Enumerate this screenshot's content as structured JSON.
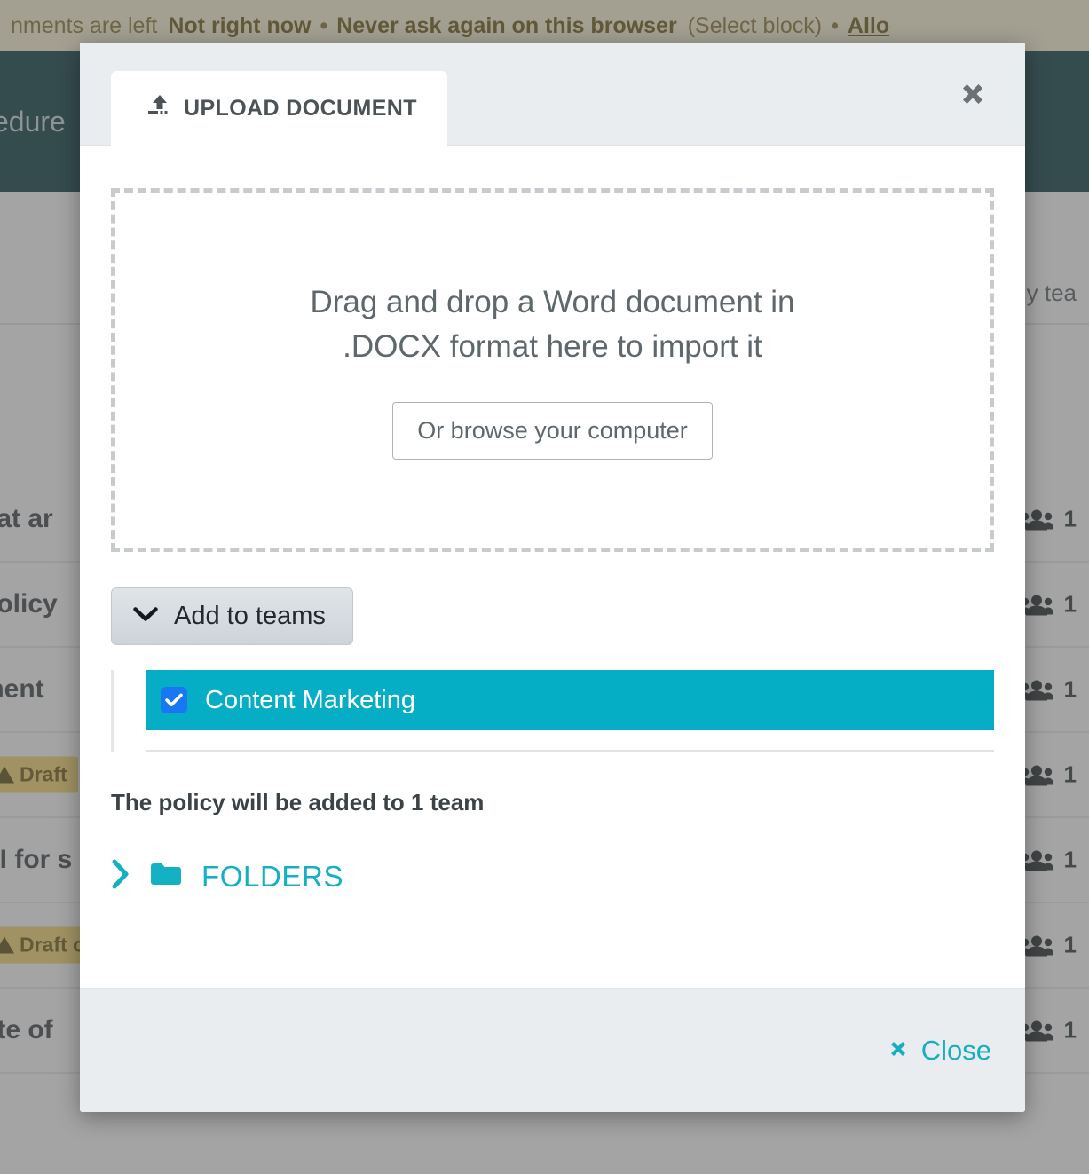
{
  "background": {
    "banner": {
      "text_before": "nments are left",
      "action_now": "Not right now",
      "separator": "•",
      "action_never": "Never ask again on this browser",
      "hint": "(Select block)",
      "action_allow": "Allo"
    },
    "topbar": {
      "title_fragment": "cedure"
    },
    "table": {
      "header_fragment": "y tea",
      "rows": [
        {
          "title": "hat ar",
          "type": "title",
          "team_count": "1"
        },
        {
          "title": "policy",
          "type": "title",
          "team_count": "1"
        },
        {
          "title": "ment",
          "type": "title",
          "team_count": "1"
        },
        {
          "title": "Draft",
          "type": "badge",
          "team_count": "1"
        },
        {
          "title": "AI for s",
          "type": "title",
          "team_count": "1"
        },
        {
          "title": "Draft o",
          "type": "badge",
          "team_count": "1"
        },
        {
          "title": "ote of",
          "type": "title",
          "team_count": "1"
        }
      ]
    }
  },
  "modal": {
    "tab": {
      "label": "UPLOAD DOCUMENT",
      "icon": "upload-icon"
    },
    "close_icon": "close-icon",
    "dropzone": {
      "line1": "Drag and drop a Word document in",
      "line2": ".DOCX format here to import it",
      "browse_label": "Or browse your computer"
    },
    "teams": {
      "toggle_label": "Add to teams",
      "toggle_icon": "chevron-down-icon",
      "items": [
        {
          "label": "Content Marketing",
          "checked": true
        }
      ]
    },
    "policy_note": "The policy will be added to 1 team",
    "folders": {
      "label": "FOLDERS",
      "chevron_icon": "chevron-right-icon",
      "folder_icon": "folder-icon"
    },
    "footer": {
      "close_label": "Close",
      "close_icon": "close-x-icon"
    }
  },
  "colors": {
    "accent_teal": "#17aec4",
    "team_row_bg": "#06aec5",
    "checkbox_blue": "#1877f2",
    "topbar_dark": "#0a3c44",
    "banner_bg": "#fdf5d8",
    "modal_chrome": "#e9edf0"
  }
}
